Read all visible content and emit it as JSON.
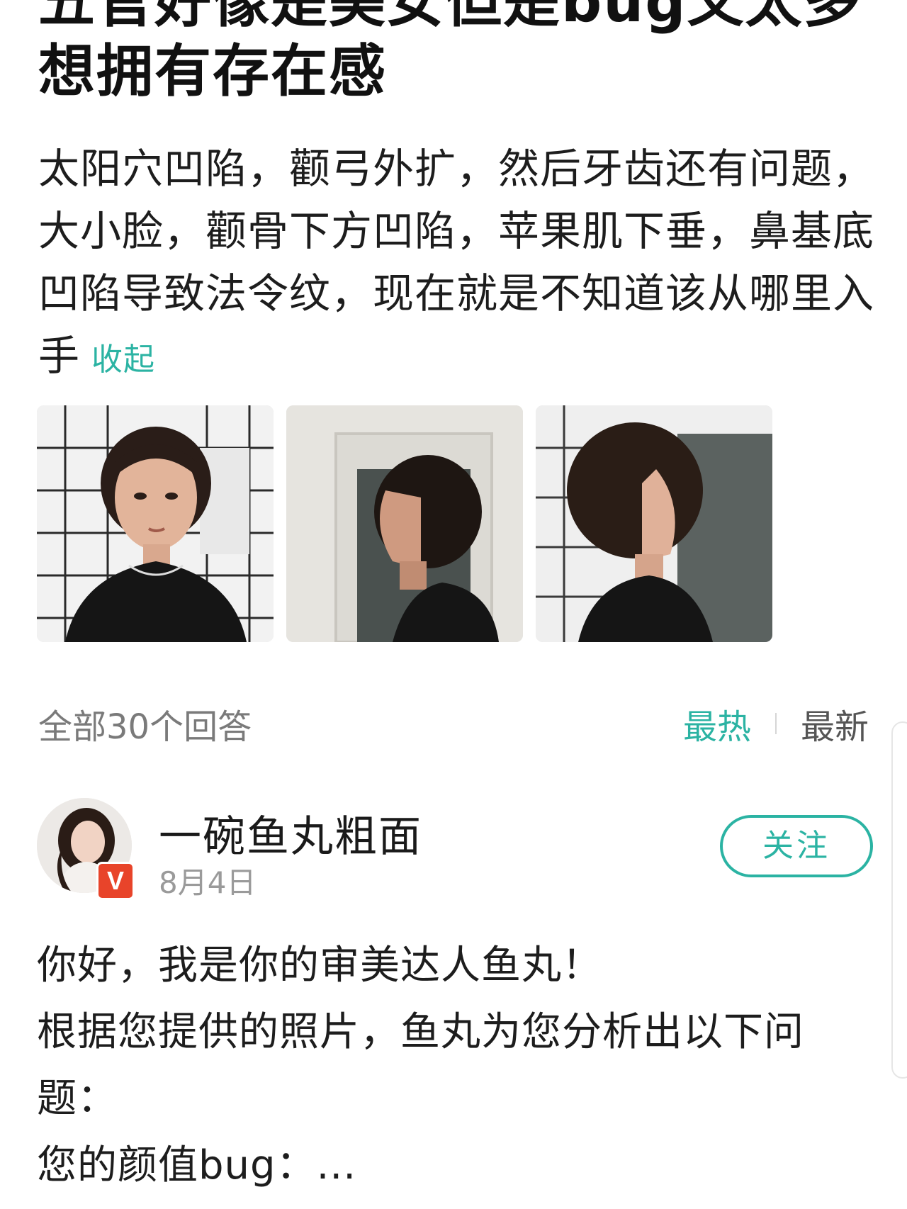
{
  "question": {
    "title_lines": [
      "五官好像是美女但是bug又太多",
      "想拥有存在感"
    ],
    "body": "太阳穴凹陷，颧弓外扩，然后牙齿还有问题，大小脸，颧骨下方凹陷，苹果肌下垂，鼻基底凹陷导致法令纹，现在就是不知道该从哪里入手",
    "collapse_label": "收起",
    "photos": [
      "front-photo",
      "left-profile-photo",
      "right-profile-photo"
    ]
  },
  "answers_bar": {
    "count_label": "全部30个回答",
    "tabs": [
      {
        "label": "最热",
        "active": true
      },
      {
        "label": "最新",
        "active": false
      }
    ]
  },
  "answer": {
    "author": "一碗鱼丸粗面",
    "date": "8月4日",
    "verified_badge": "V",
    "follow_label": "关注",
    "lines": [
      "你好，我是你的审美达人鱼丸！",
      "根据您提供的照片，鱼丸为您分析出以下问题：",
      "您的颜值bug：..."
    ]
  },
  "colors": {
    "accent": "#2bb3a3",
    "badge": "#e8442a",
    "muted_text": "#7a7a7a"
  }
}
